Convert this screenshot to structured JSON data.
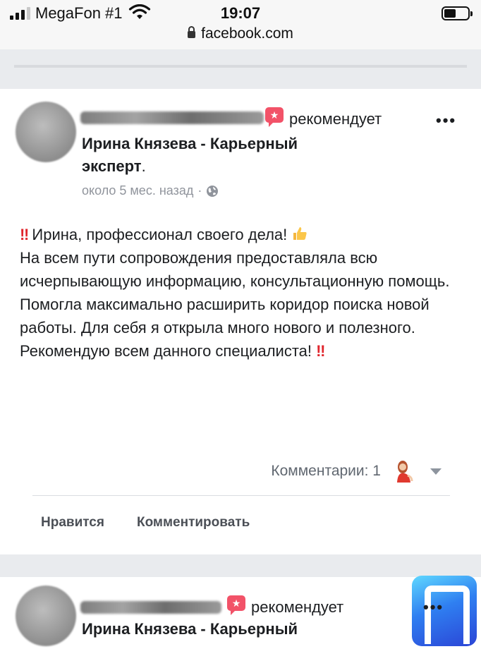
{
  "status_bar": {
    "carrier": "MegaFon #1",
    "time": "19:07",
    "url": "facebook.com",
    "signal_bars": 4,
    "signal_bars_active": 3,
    "battery_level": 0.4
  },
  "posts": [
    {
      "recommends_text": "рекомендует",
      "page_name": "Ирина Князева - Карьерный эксперт",
      "name_suffix": ".",
      "timestamp": "около 5 мес. назад",
      "separator": "·",
      "audience_icon": "globe-icon",
      "more_icon": "•••",
      "body": {
        "line1_text": "Ирина, профессионал своего дела!",
        "middle": "На всем пути сопровождения предоставляла всю исчерпывающую информацию, консультационную помощь. Помогла максимально расширить коридор поиска новой работы. Для себя я открыла много нового и полезного.",
        "last_text": "Рекомендую всем данного специалиста!",
        "emphasis": "‼"
      },
      "comments_label": "Комментарии: 1",
      "actions": {
        "like": "Нравится",
        "comment": "Комментировать"
      }
    },
    {
      "recommends_text": "рекомендует",
      "page_name": "Ирина Князева - Карьерный",
      "more_icon": "•••"
    }
  ],
  "colors": {
    "feed_background": "#e9ebee",
    "recommend_badge": "#f25268",
    "emphasis_red": "#e0262d",
    "meta_gray": "#90949c",
    "logo_gradient_start": "#5fd8ff",
    "logo_gradient_end": "#2b45d6"
  }
}
